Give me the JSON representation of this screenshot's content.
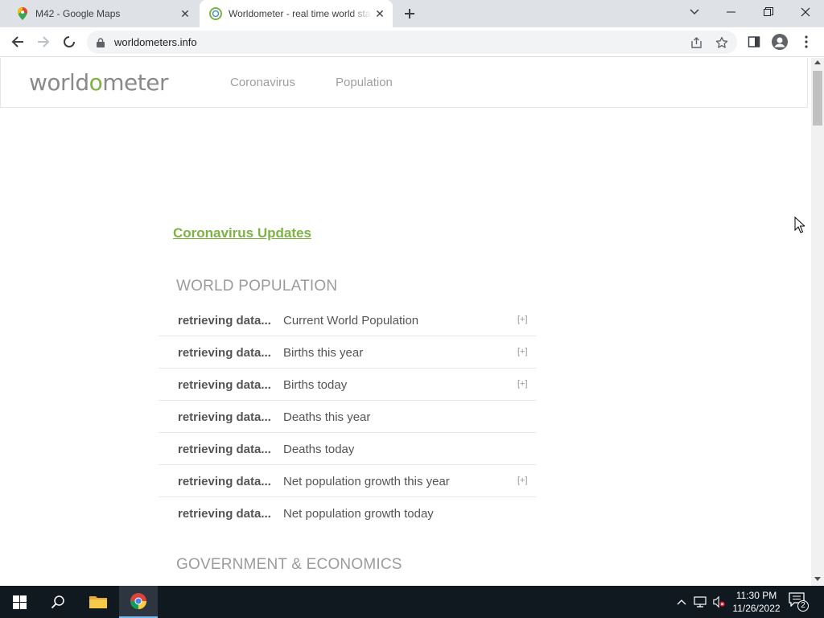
{
  "browser": {
    "tabs": [
      {
        "title": "M42 - Google Maps",
        "favicon": "google-maps-pin-icon"
      },
      {
        "title": "Worldometer - real time world statistics",
        "favicon": "worldometer-globe-icon"
      }
    ],
    "url": "worldometers.info"
  },
  "site": {
    "logo": {
      "part1": "world",
      "part2": "o",
      "part3": "meter"
    },
    "nav": [
      "Coronavirus",
      "Population"
    ],
    "coronavirus_link": "Coronavirus Updates",
    "sections": {
      "world_population": "WORLD POPULATION",
      "government_economics": "GOVERNMENT & ECONOMICS"
    },
    "counters": [
      {
        "value": "retrieving data...",
        "label": "Current World Population",
        "expand": "[+]"
      },
      {
        "value": "retrieving data...",
        "label": "Births this year",
        "expand": "[+]"
      },
      {
        "value": "retrieving data...",
        "label": "Births today",
        "expand": "[+]"
      },
      {
        "value": "retrieving data...",
        "label": "Deaths this year",
        "expand": ""
      },
      {
        "value": "retrieving data...",
        "label": "Deaths today",
        "expand": ""
      },
      {
        "value": "retrieving data...",
        "label": "Net population growth this year",
        "expand": "[+]"
      },
      {
        "value": "retrieving data...",
        "label": "Net population growth today",
        "expand": ""
      }
    ]
  },
  "taskbar": {
    "time": "11:30 PM",
    "date": "11/26/2022",
    "notification_count": "2"
  },
  "colors": {
    "accent_green": "#7cb342",
    "taskbar": "#101820",
    "tabstrip": "#dee1e6"
  }
}
